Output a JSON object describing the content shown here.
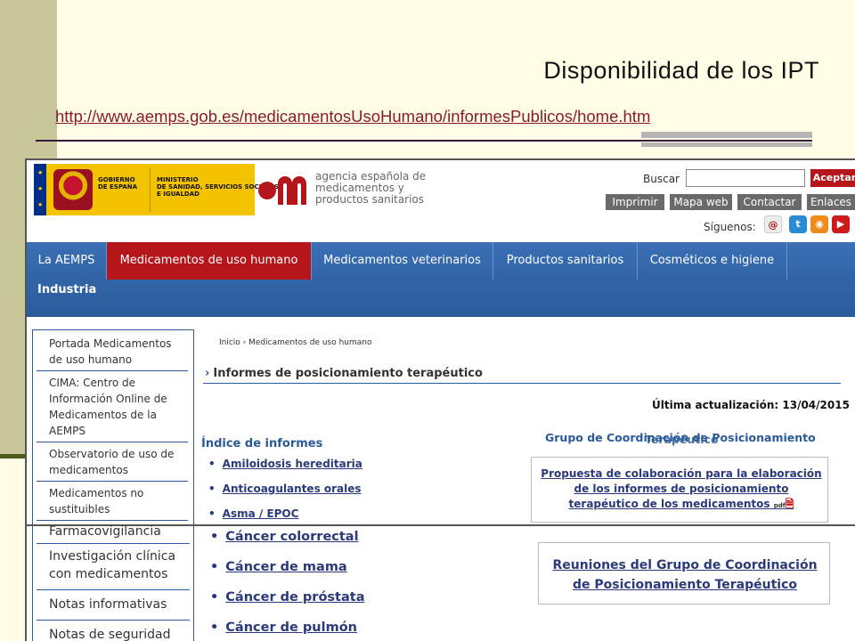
{
  "slide": {
    "title": "Disponibilidad de los IPT",
    "url": "http://www.aemps.gob.es/medicamentosUsoHumano/informesPublicos/home.htm"
  },
  "header": {
    "gov_text": "GOBIERNO\nDE ESPAÑA",
    "ministry_text": "MINISTERIO\nDE SANIDAD, SERVICIOS SOCIALES\nE IGUALDAD",
    "agency_text": "agencia española de\nmedicamentos y\nproductos sanitarios",
    "search_label": "Buscar",
    "search_value": "",
    "accept_label": "Aceptar",
    "tools": [
      "Imprimir",
      "Mapa web",
      "Contactar",
      "Enlaces"
    ],
    "follow_label": "Síguenos:"
  },
  "nav": {
    "items": [
      "La AEMPS",
      "Medicamentos de uso humano",
      "Medicamentos veterinarios",
      "Productos sanitarios",
      "Cosméticos e higiene"
    ],
    "second_row": "Industria"
  },
  "sidebar": {
    "items": [
      "Portada Medicamentos de uso humano",
      "CIMA: Centro de Información Online de Medicamentos de la AEMPS",
      "Observatorio de uso de medicamentos",
      "Medicamentos no sustituibles"
    ]
  },
  "main": {
    "breadcrumb": "Inicio › Medicamentos de uso humano",
    "heading": "Informes de posicionamiento terapéutico",
    "updated": "Última actualización: 13/04/2015",
    "index_title": "Índice de informes",
    "index_items": [
      "Amiloidosis hereditaria",
      "Anticoagulantes orales",
      "Asma / EPOC"
    ],
    "group_title": "Grupo de Coordinación de Posicionamiento",
    "group_title_2": "Terapéutico",
    "proposal": "Propuesta de colaboración para la elaboración de los informes de posicionamiento terapéutico de los medicamentos",
    "pdf_label": "pdf"
  },
  "lower": {
    "sidebar_items": [
      "Farmacovigilancia",
      "Investigación clínica con medicamentos",
      "Notas informativas",
      "Notas de seguridad"
    ],
    "index_items": [
      "Cáncer colorrectal",
      "Cáncer de mama",
      "Cáncer de próstata",
      "Cáncer de pulmón"
    ],
    "meetings": "Reuniones del Grupo de Coordinación de Posicionamiento Terapéutico"
  },
  "colors": {
    "accent_red": "#b4161b",
    "nav_blue": "#2a5a9a",
    "slide_bg": "#fffde6",
    "olive": "#c8c79a"
  }
}
